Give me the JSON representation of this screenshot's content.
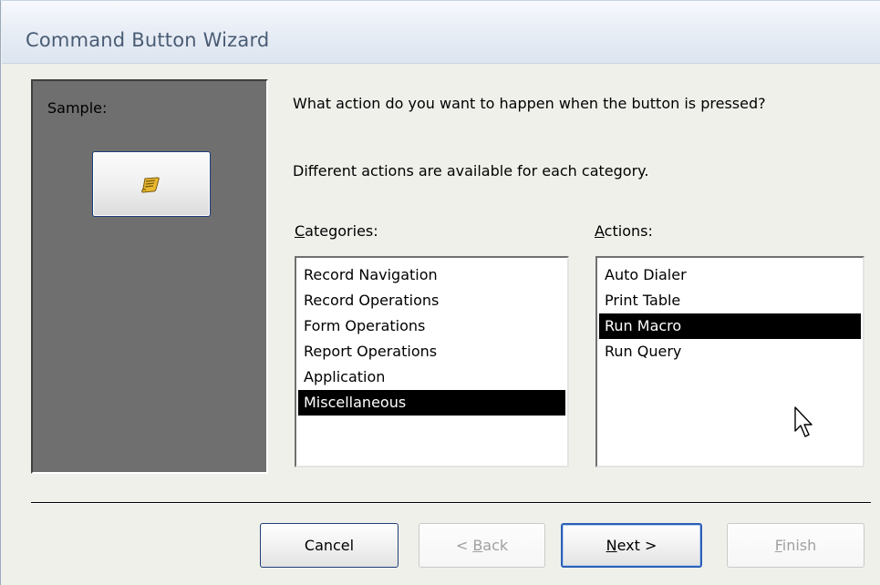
{
  "window": {
    "title": "Command Button Wizard"
  },
  "sample": {
    "label": "Sample:",
    "icon": "macro-scroll-icon"
  },
  "prompt": {
    "question": "What action do you want to happen when the button is pressed?",
    "subtext": "Different actions are available for each category."
  },
  "categories": {
    "label_accel": "C",
    "label_rest": "ategories:",
    "items": [
      "Record Navigation",
      "Record Operations",
      "Form Operations",
      "Report Operations",
      "Application",
      "Miscellaneous"
    ],
    "selected": "Miscellaneous"
  },
  "actions": {
    "label_accel": "A",
    "label_rest": "ctions:",
    "items": [
      "Auto Dialer",
      "Print Table",
      "Run Macro",
      "Run Query"
    ],
    "selected": "Run Macro"
  },
  "buttons": {
    "cancel": "Cancel",
    "back_pre": "< ",
    "back_accel": "B",
    "back_rest": "ack",
    "next_accel": "N",
    "next_rest": "ext >",
    "finish_accel": "F",
    "finish_rest": "inish"
  },
  "colors": {
    "selection": "#000000",
    "panel": "#6f6f6f",
    "dialog": "#f0f0eb"
  }
}
